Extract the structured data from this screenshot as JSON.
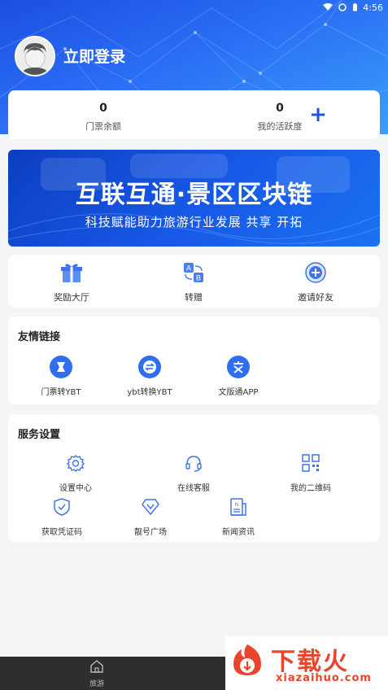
{
  "status_bar": {
    "time": "4:56",
    "wifi_icon": "wifi-icon",
    "signal_icon": "signal-icon",
    "battery_icon": "battery-icon"
  },
  "profile": {
    "login_label": "立即登录",
    "avatar_icon": "avatar-icon"
  },
  "stats": [
    {
      "value": "0",
      "label": "门票余额"
    },
    {
      "value": "0",
      "label": "我的活跃度"
    }
  ],
  "stats_add_icon": "plus-icon",
  "banner": {
    "title": "互联互通·景区区块链",
    "subtitle": "科技赋能助力旅游行业发展  共享  开拓"
  },
  "quick_actions": [
    {
      "label": "奖励大厅",
      "icon": "gift-icon"
    },
    {
      "label": "转赠",
      "icon": "transfer-icon"
    },
    {
      "label": "邀请好友",
      "icon": "invite-icon"
    }
  ],
  "links_section": {
    "title": "友情链接",
    "items": [
      {
        "label": "门票转YBT",
        "icon": "ticket-ybt-icon"
      },
      {
        "label": "ybt转换YBT",
        "icon": "exchange-icon"
      },
      {
        "label": "文版通APP",
        "icon": "wenbantong-icon"
      }
    ]
  },
  "services_section": {
    "title": "服务设置",
    "items": [
      {
        "label": "设置中心",
        "icon": "gear-icon"
      },
      {
        "label": "在线客服",
        "icon": "headset-icon"
      },
      {
        "label": "我的二维码",
        "icon": "qrcode-icon"
      },
      {
        "label": "获取凭证码",
        "icon": "shield-check-icon"
      },
      {
        "label": "靓号广场",
        "icon": "diamond-icon"
      },
      {
        "label": "新闻资讯",
        "icon": "news-icon"
      }
    ]
  },
  "bottom_nav": {
    "items": [
      {
        "label": "旅游",
        "icon": "home-icon"
      }
    ]
  },
  "watermark": {
    "text_cn": "下载火",
    "text_en": "xiazaihuo.com"
  },
  "colors": {
    "primary": "#1d56d9",
    "header_start": "#1c4fe0",
    "header_end": "#3aa0f8",
    "watermark": "#e8452c"
  }
}
